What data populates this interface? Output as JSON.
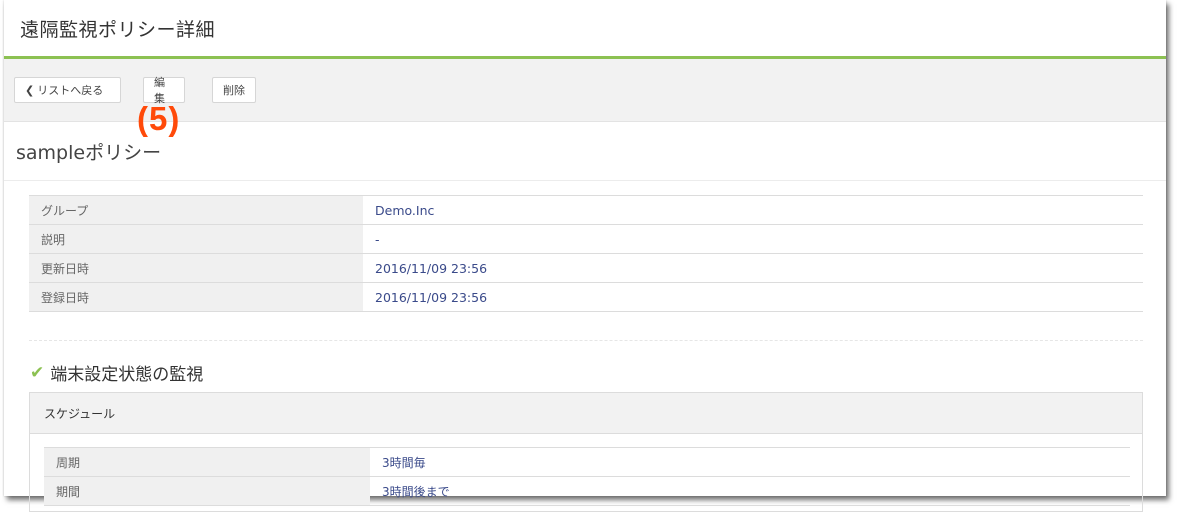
{
  "header": {
    "title": "遠隔監視ポリシー詳細"
  },
  "toolbar": {
    "back_label": "リストへ戻る",
    "back_icon": "chevron-left-icon",
    "edit_label": "編集",
    "delete_label": "削除"
  },
  "annotation": "(5)",
  "policy": {
    "name": "sampleポリシー"
  },
  "info_rows": [
    {
      "key": "グループ",
      "value": "Demo.Inc"
    },
    {
      "key": "説明",
      "value": "-"
    },
    {
      "key": "更新日時",
      "value": "2016/11/09 23:56"
    },
    {
      "key": "登録日時",
      "value": "2016/11/09 23:56"
    }
  ],
  "monitor": {
    "title": "端末設定状態の監視",
    "icon": "check-icon"
  },
  "schedule": {
    "title": "スケジュール",
    "rows": [
      {
        "key": "周期",
        "value": "3時間毎"
      },
      {
        "key": "期間",
        "value": "3時間後まで"
      }
    ]
  },
  "colors": {
    "accent": "#8cc152",
    "annotation": "#ff4a0a",
    "link": "#3a4a8a"
  }
}
